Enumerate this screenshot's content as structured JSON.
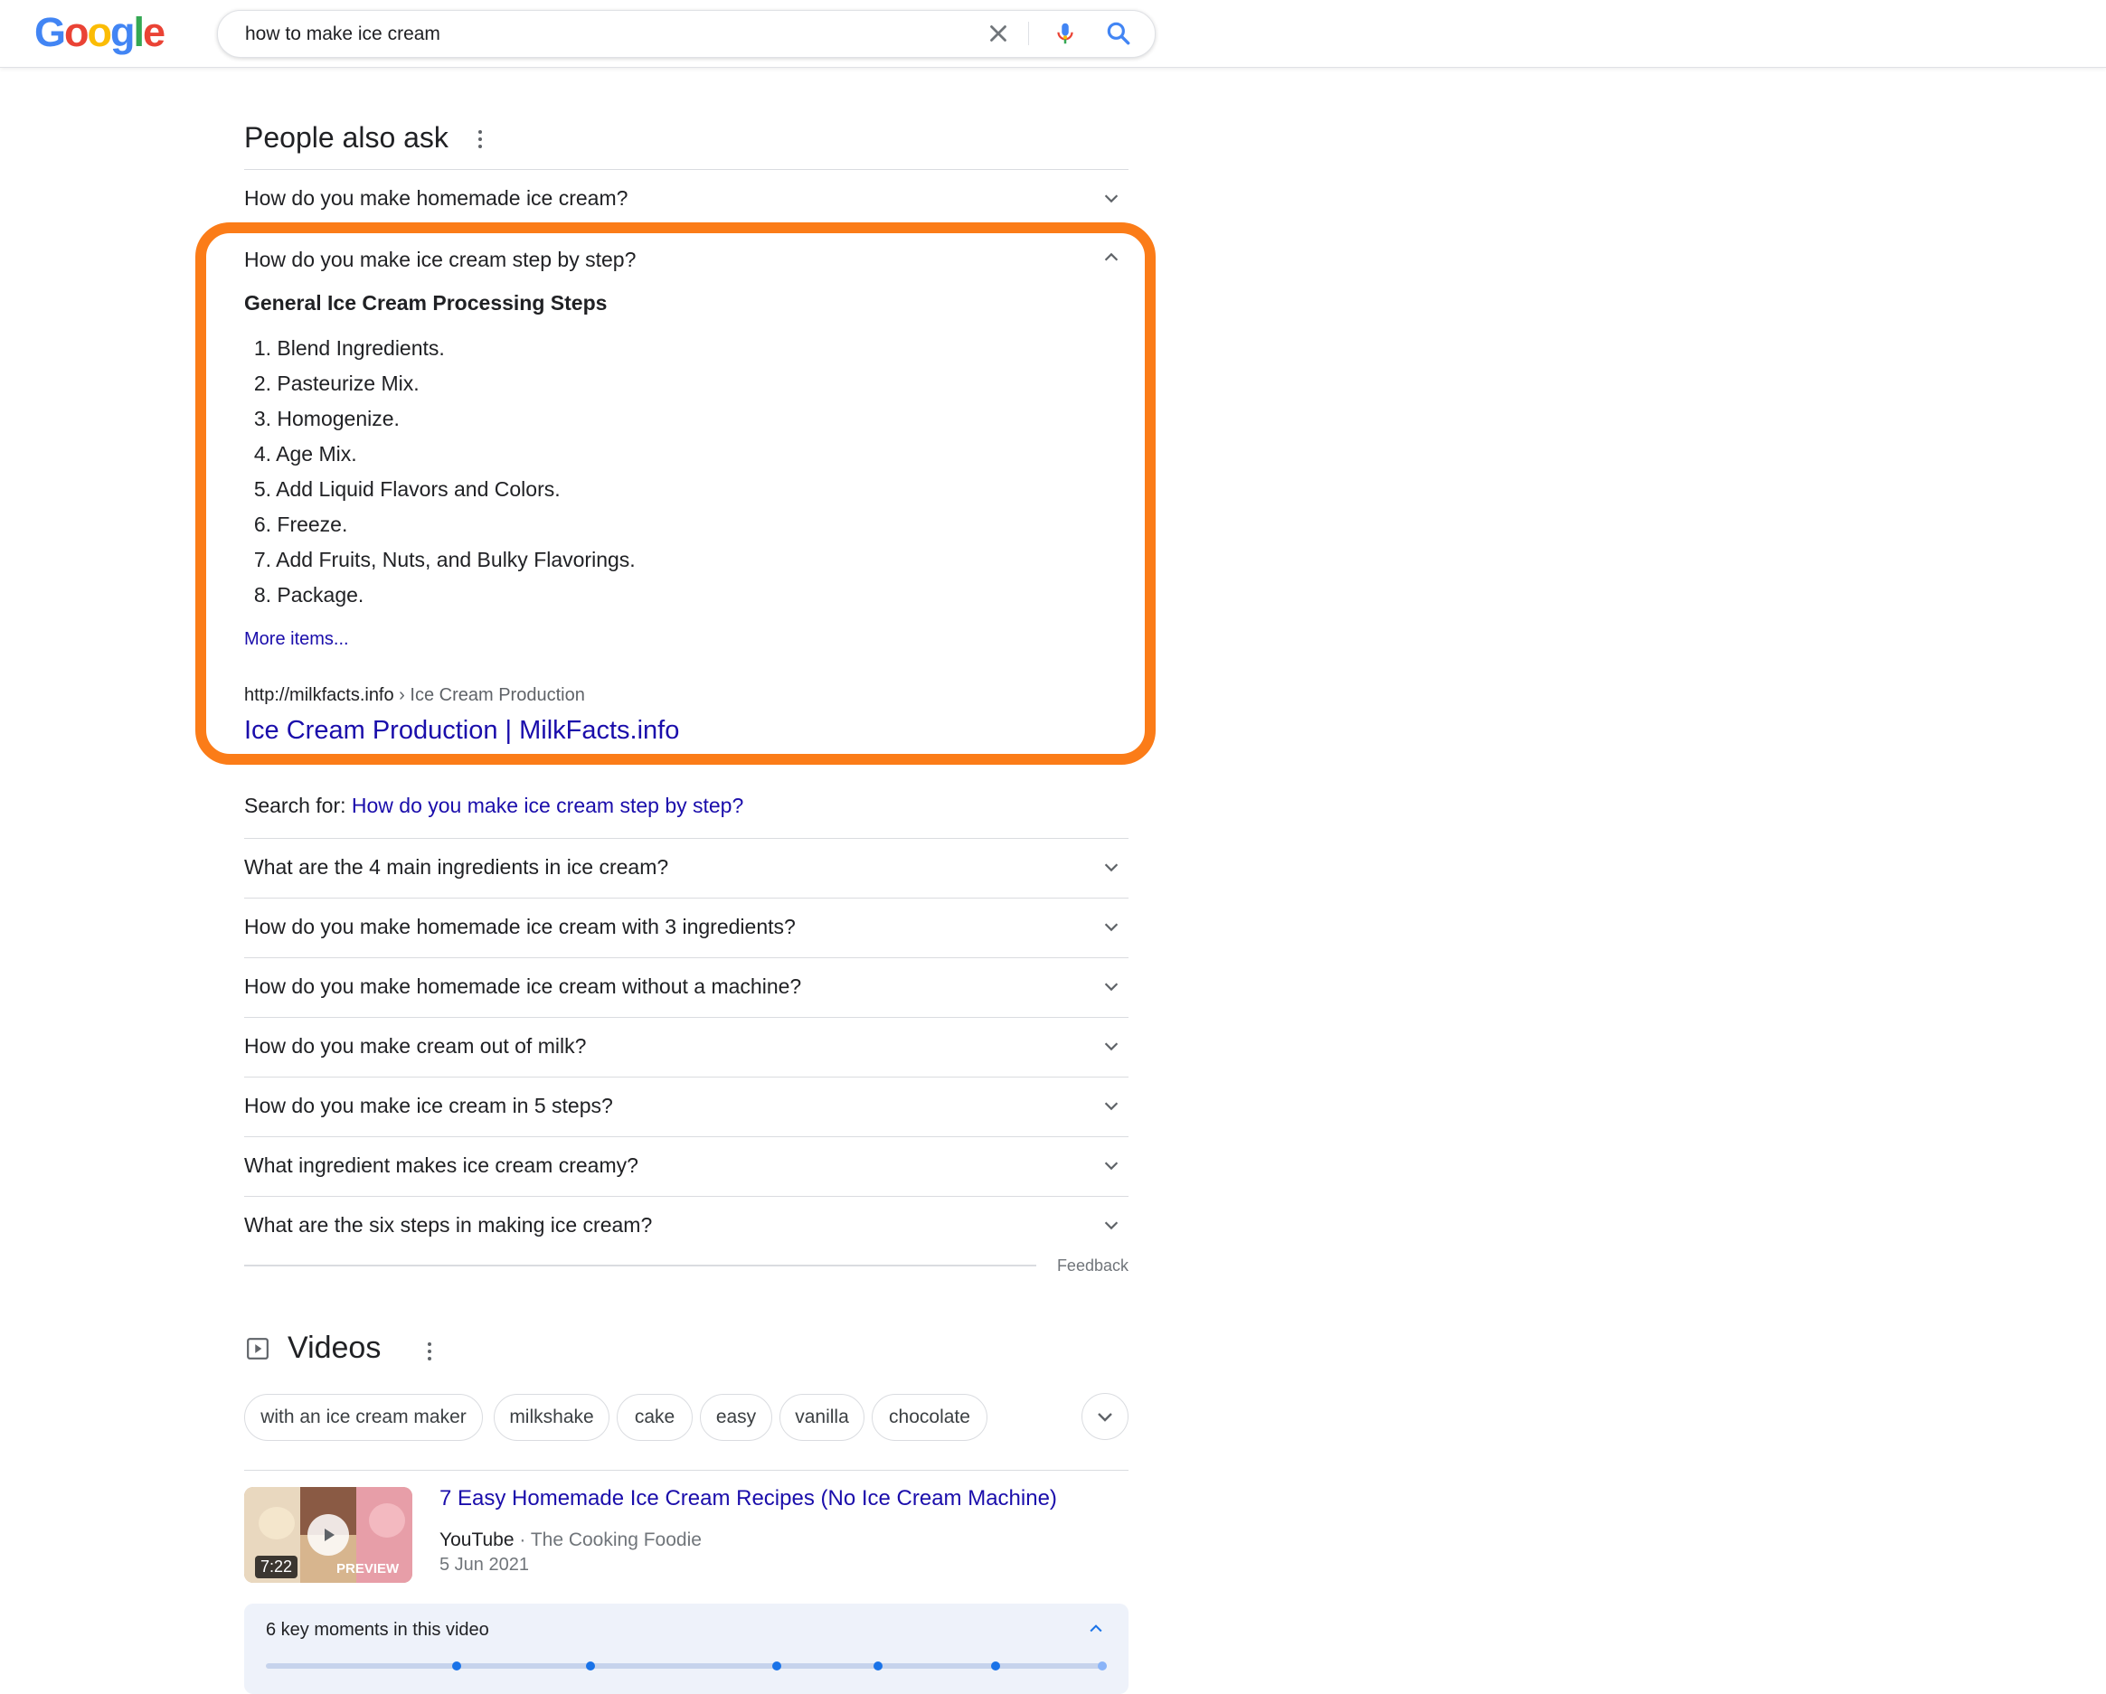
{
  "header": {
    "logo_letters": [
      {
        "char": "G",
        "color": "#4285F4"
      },
      {
        "char": "o",
        "color": "#EA4335"
      },
      {
        "char": "o",
        "color": "#FBBC05"
      },
      {
        "char": "g",
        "color": "#4285F4"
      },
      {
        "char": "l",
        "color": "#34A853"
      },
      {
        "char": "e",
        "color": "#EA4335"
      }
    ],
    "search_query": "how to make ice cream",
    "icons": [
      "close-icon",
      "mic-icon",
      "search-icon"
    ]
  },
  "people_also_ask": {
    "title": "People also ask",
    "questions_above": [
      "How do you make homemade ice cream?"
    ],
    "expanded": {
      "question": "How do you make ice cream step by step?",
      "heading": "General Ice Cream Processing Steps",
      "steps": [
        {
          "num": "1.",
          "text": "Blend Ingredients."
        },
        {
          "num": "2.",
          "text": "Pasteurize Mix."
        },
        {
          "num": "3.",
          "text": "Homogenize."
        },
        {
          "num": "4.",
          "text": "Age Mix."
        },
        {
          "num": "5.",
          "text": "Add Liquid Flavors and Colors."
        },
        {
          "num": "6.",
          "text": "Freeze."
        },
        {
          "num": "7.",
          "text": "Add Fruits, Nuts, and Bulky Flavorings."
        },
        {
          "num": "8.",
          "text": "Package."
        }
      ],
      "more_items": "More items...",
      "cite_url": "http://milkfacts.info",
      "cite_breadcrumb": " › Ice Cream Production",
      "result_title": "Ice Cream Production | MilkFacts.info",
      "highlight_color": "#fb7c18",
      "search_for_label": "Search for: ",
      "search_for_link": "How do you make ice cream step by step?"
    },
    "questions_below": [
      "What are the 4 main ingredients in ice cream?",
      "How do you make homemade ice cream with 3 ingredients?",
      "How do you make homemade ice cream without a machine?",
      "How do you make cream out of milk?",
      "How do you make ice cream in 5 steps?",
      "What ingredient makes ice cream creamy?",
      "What are the six steps in making ice cream?"
    ],
    "feedback": "Feedback"
  },
  "videos": {
    "title": "Videos",
    "chips": [
      "with an ice cream maker",
      "milkshake",
      "cake",
      "easy",
      "vanilla",
      "chocolate"
    ],
    "video": {
      "title": "7 Easy Homemade Ice Cream Recipes (No Ice Cream Machine)",
      "source": "YouTube",
      "channel": " · The Cooking Foodie",
      "date": "5 Jun 2021",
      "duration": "7:22",
      "preview_label": "PREVIEW"
    },
    "key_moments": {
      "label": "6 key moments in this video",
      "count": 6
    }
  },
  "colors": {
    "link": "#1a0dab",
    "text": "#202124",
    "secondary": "#70757a",
    "moments_bg": "#eef2fa"
  }
}
